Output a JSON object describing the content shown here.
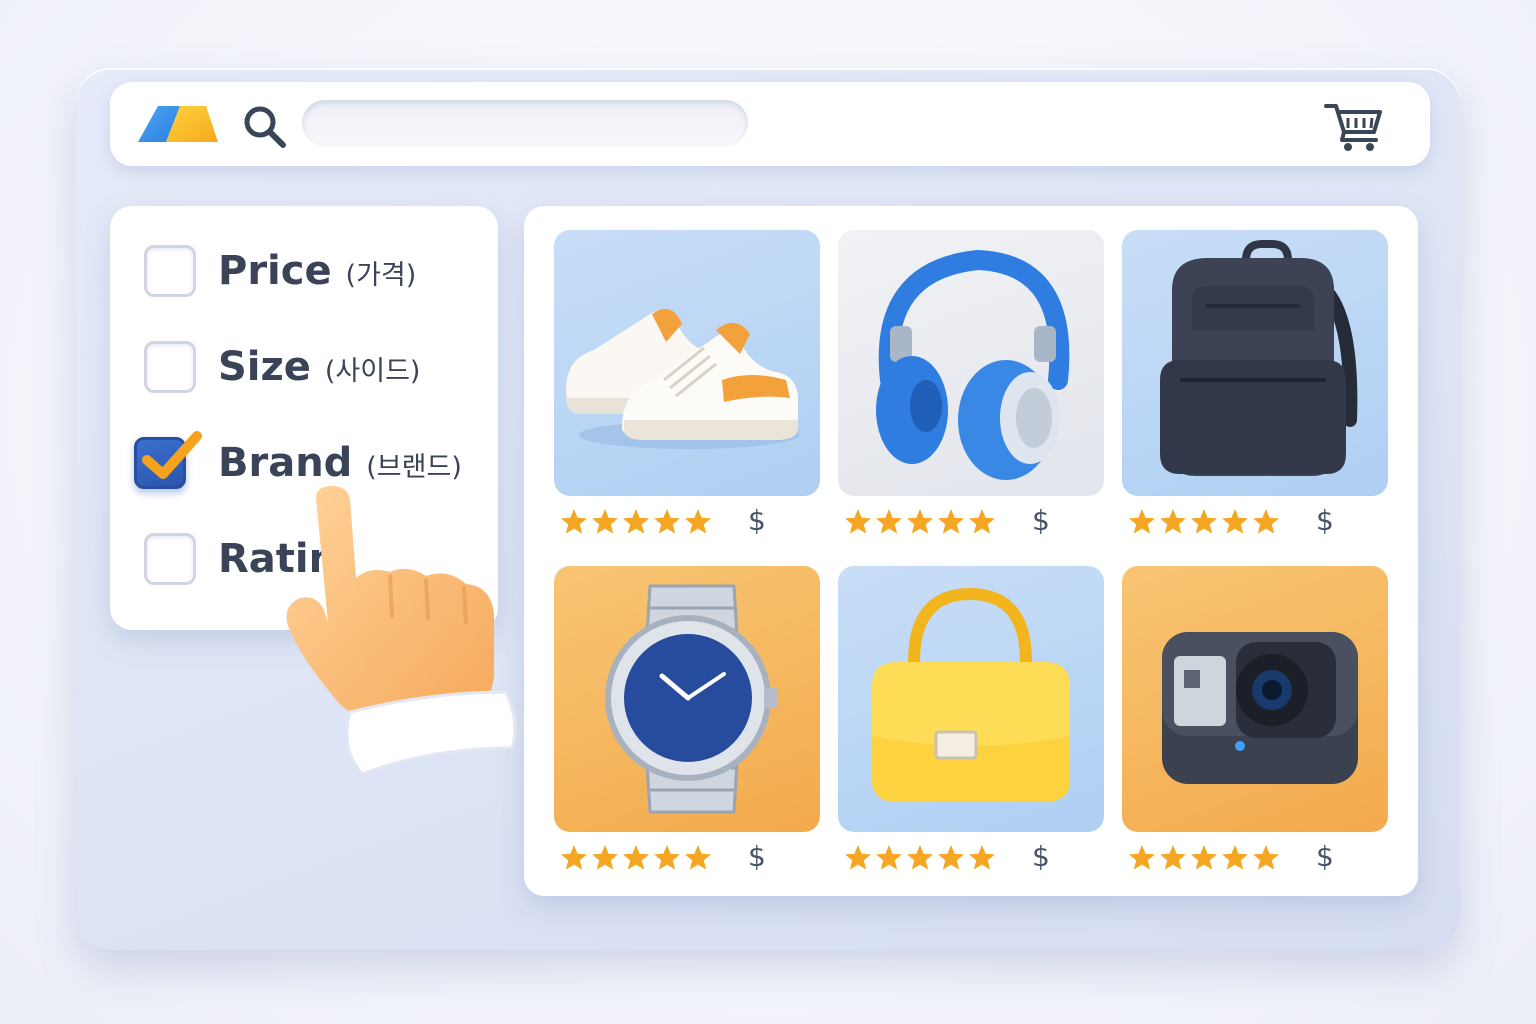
{
  "header": {
    "search": {
      "value": "",
      "placeholder": ""
    },
    "icons": {
      "logo": "brand-logo",
      "search": "search-icon",
      "cart": "shopping-cart-icon"
    }
  },
  "filters": [
    {
      "label": "Price",
      "sub": "(가격)",
      "checked": false
    },
    {
      "label": "Size",
      "sub": "(사이드)",
      "checked": false
    },
    {
      "label": "Brand",
      "sub": "(브랜드)",
      "checked": true
    },
    {
      "label": "Ratin",
      "sub": "",
      "checked": false
    }
  ],
  "products": [
    {
      "item": "sneakers",
      "rating": 5,
      "price_label": "$"
    },
    {
      "item": "headphones",
      "rating": 5,
      "price_label": "$"
    },
    {
      "item": "backpack",
      "rating": 5,
      "price_label": "$"
    },
    {
      "item": "wristwatch",
      "rating": 5,
      "price_label": "$"
    },
    {
      "item": "handbag",
      "rating": 5,
      "price_label": "$"
    },
    {
      "item": "action-camera",
      "rating": 5,
      "price_label": "$"
    }
  ],
  "colors": {
    "accent_blue": "#2f62c4",
    "accent_orange": "#f5a43a",
    "star": "#f5a623",
    "text": "#3a4357"
  }
}
